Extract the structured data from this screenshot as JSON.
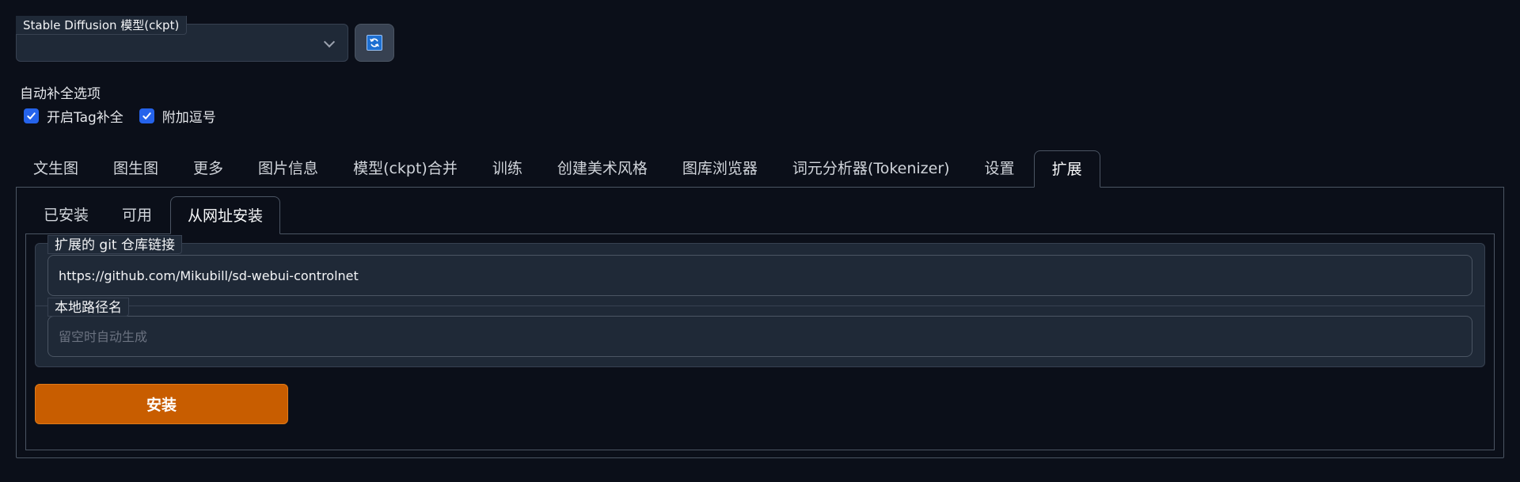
{
  "model": {
    "label": "Stable Diffusion 模型(ckpt)",
    "selected": ""
  },
  "icons": {
    "refresh": "refresh-icon",
    "chevron": "chevron-down-icon",
    "check": "check-icon"
  },
  "autocomplete": {
    "title": "自动补全选项",
    "options": [
      {
        "label": "开启Tag补全",
        "checked": true
      },
      {
        "label": "附加逗号",
        "checked": true
      }
    ]
  },
  "main_tabs": [
    {
      "label": "文生图"
    },
    {
      "label": "图生图"
    },
    {
      "label": "更多"
    },
    {
      "label": "图片信息"
    },
    {
      "label": "模型(ckpt)合并"
    },
    {
      "label": "训练"
    },
    {
      "label": "创建美术风格"
    },
    {
      "label": "图库浏览器"
    },
    {
      "label": "词元分析器(Tokenizer)"
    },
    {
      "label": "设置"
    },
    {
      "label": "扩展",
      "active": true
    }
  ],
  "sub_tabs": [
    {
      "label": "已安装"
    },
    {
      "label": "可用"
    },
    {
      "label": "从网址安装",
      "active": true
    }
  ],
  "install_form": {
    "git_url_label": "扩展的 git 仓库链接",
    "git_url_value": "https://github.com/Mikubill/sd-webui-controlnet",
    "local_dir_label": "本地路径名",
    "local_dir_placeholder": "留空时自动生成",
    "install_button": "安装"
  },
  "colors": {
    "background": "#0b0f19",
    "panel": "#1f2937",
    "accent_orange": "#c85d00",
    "checkbox_blue": "#2563eb"
  }
}
